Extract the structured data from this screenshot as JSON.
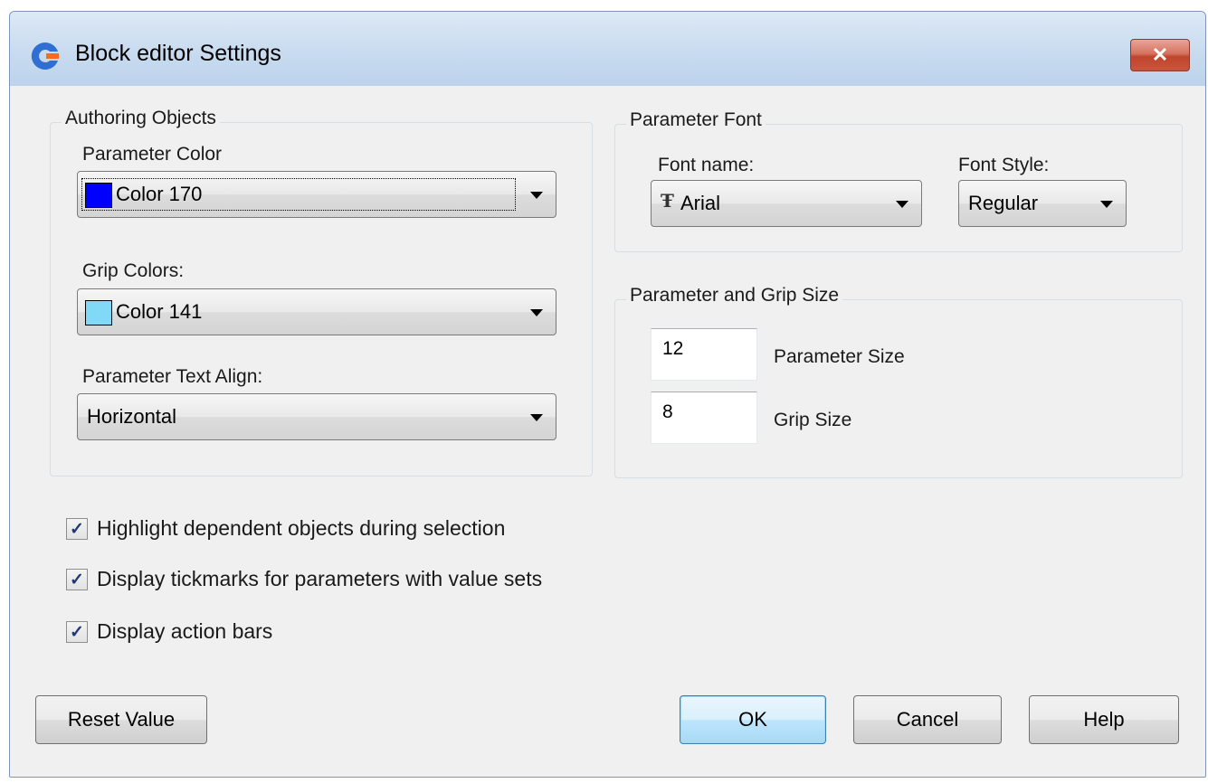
{
  "window": {
    "title": "Block editor Settings",
    "close_label": "✕"
  },
  "authoring": {
    "title": "Authoring Objects",
    "param_color_label": "Parameter Color",
    "param_color_value": "Color 170",
    "param_color_swatch": "#0000ff",
    "grip_colors_label": "Grip Colors:",
    "grip_colors_value": "Color 141",
    "grip_colors_swatch": "#7fd9f7",
    "text_align_label": "Parameter Text Align:",
    "text_align_value": "Horizontal"
  },
  "param_font": {
    "title": "Parameter Font",
    "font_name_label": "Font name:",
    "font_name_value": "Arial",
    "font_icon": "truetype-font-icon",
    "font_style_label": "Font Style:",
    "font_style_value": "Regular"
  },
  "sizes": {
    "title": "Parameter and Grip Size",
    "param_size_value": "12",
    "param_size_label": "Parameter Size",
    "grip_size_value": "8",
    "grip_size_label": "Grip Size"
  },
  "options": [
    {
      "label": "Highlight dependent objects during selection",
      "checked": true
    },
    {
      "label": "Display tickmarks for parameters with value sets",
      "checked": true
    },
    {
      "label": "Display action bars",
      "checked": true
    }
  ],
  "buttons": {
    "reset": "Reset Value",
    "ok": "OK",
    "cancel": "Cancel",
    "help": "Help"
  },
  "colors": {
    "accent_ok_border": "#3c7fb1",
    "close_red": "#c0452d",
    "title_bar": "#c8dbef"
  }
}
